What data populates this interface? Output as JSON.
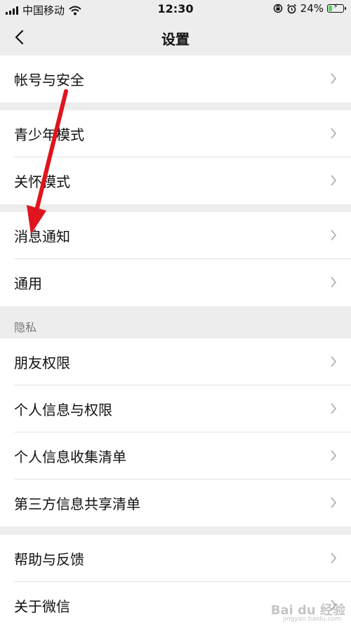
{
  "status_bar": {
    "carrier": "中国移动",
    "time": "12:30",
    "battery_percent": "24%",
    "battery_level": 0.24,
    "battery_color": "#4cd964",
    "icons": [
      "signal-icon",
      "wifi-icon",
      "orientation-lock-icon",
      "alarm-icon",
      "battery-icon"
    ]
  },
  "nav": {
    "title": "设置",
    "back_icon": "chevron-left-icon"
  },
  "groups": [
    {
      "items": [
        {
          "label": "帐号与安全"
        }
      ]
    },
    {
      "items": [
        {
          "label": "青少年模式"
        },
        {
          "label": "关怀模式"
        }
      ]
    },
    {
      "items": [
        {
          "label": "消息通知"
        },
        {
          "label": "通用"
        }
      ]
    },
    {
      "header": "隐私",
      "items": [
        {
          "label": "朋友权限"
        },
        {
          "label": "个人信息与权限"
        },
        {
          "label": "个人信息收集清单"
        },
        {
          "label": "第三方信息共享清单"
        }
      ]
    },
    {
      "items": [
        {
          "label": "帮助与反馈"
        },
        {
          "label": "关于微信"
        }
      ]
    }
  ],
  "annotation": {
    "type": "arrow",
    "color": "#e0141e",
    "points_to": "消息通知"
  },
  "watermark": {
    "text": "Bai du 经验",
    "sub": "jingyan.baidu.com"
  }
}
